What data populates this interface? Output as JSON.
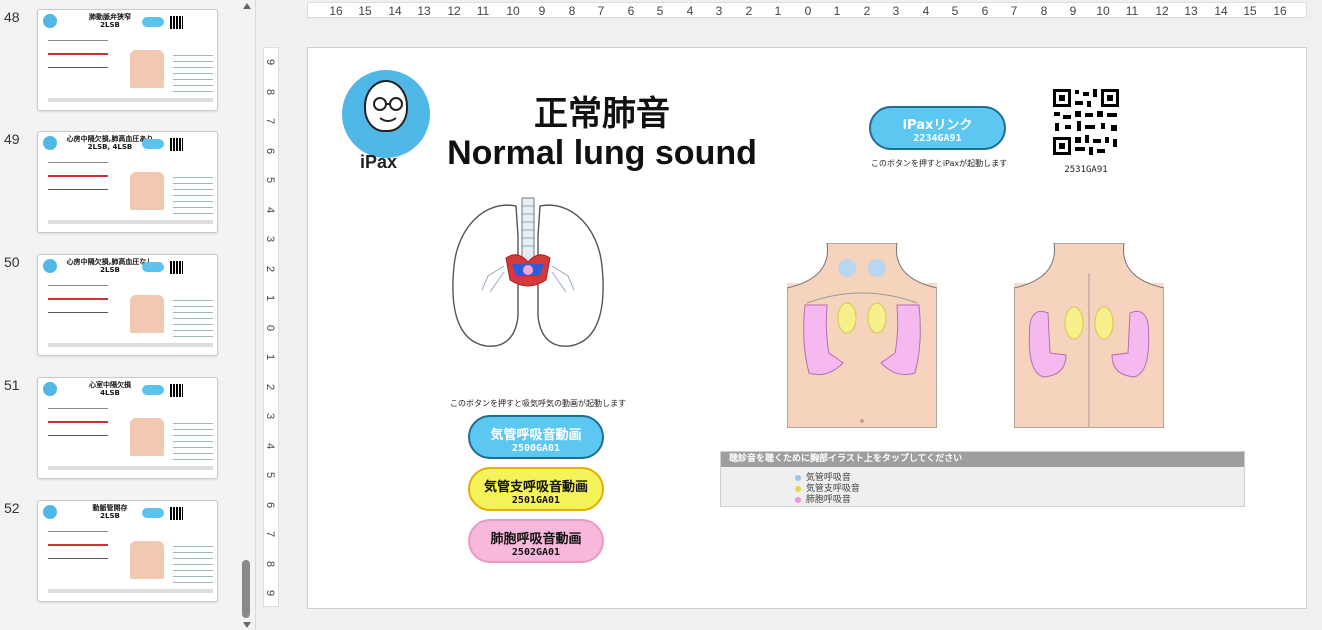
{
  "thumbnails": [
    {
      "number": "48",
      "title": "肺動脈弁狭窄\n2LSB"
    },
    {
      "number": "49",
      "title": "心房中隔欠損,肺高血圧あり\n2LSB, 4LSB"
    },
    {
      "number": "50",
      "title": "心房中隔欠損,肺高血圧なし\n2LSB"
    },
    {
      "number": "51",
      "title": "心室中隔欠損\n4LSB"
    },
    {
      "number": "52",
      "title": "動脈管開存\n2LSB"
    }
  ],
  "ruler_h": [
    "16",
    "15",
    "14",
    "13",
    "12",
    "11",
    "10",
    "9",
    "8",
    "7",
    "6",
    "5",
    "4",
    "3",
    "2",
    "1",
    "0",
    "1",
    "2",
    "3",
    "4",
    "5",
    "6",
    "7",
    "8",
    "9",
    "10",
    "11",
    "12",
    "13",
    "14",
    "15",
    "16"
  ],
  "ruler_v": [
    "9",
    "8",
    "7",
    "6",
    "5",
    "4",
    "3",
    "2",
    "1",
    "0",
    "1",
    "2",
    "3",
    "4",
    "5",
    "6",
    "7",
    "8",
    "9"
  ],
  "slide": {
    "logo_text": "iPax",
    "title_jp": "正常肺音",
    "title_en": "Normal lung sound",
    "ipax_button": {
      "label": "iPaxリンク",
      "code": "2234GA91"
    },
    "ipax_caption": "このボタンを押すとiPaxが起動します",
    "qr_caption": "2531GA91",
    "video_caption": "このボタンを押すと吸気呼気の動画が起動します",
    "video_buttons": [
      {
        "label": "気管呼吸音動画",
        "code": "2500GA01"
      },
      {
        "label": "気管支呼吸音動画",
        "code": "2501GA01"
      },
      {
        "label": "肺胞呼吸音動画",
        "code": "2502GA01"
      }
    ],
    "legend": {
      "header": "聴診音を聴くために胸部イラスト上をタップしてください",
      "items": [
        {
          "label": "気管呼吸音",
          "color": "#9cc7ea"
        },
        {
          "label": "気管支呼吸音",
          "color": "#f3d24a"
        },
        {
          "label": "肺胞呼吸音",
          "color": "#ef8fe0"
        }
      ]
    }
  },
  "colors": {
    "accent_blue": "#5cc8f2",
    "yellow": "#f6f35a",
    "pink": "#f8b8dc"
  }
}
